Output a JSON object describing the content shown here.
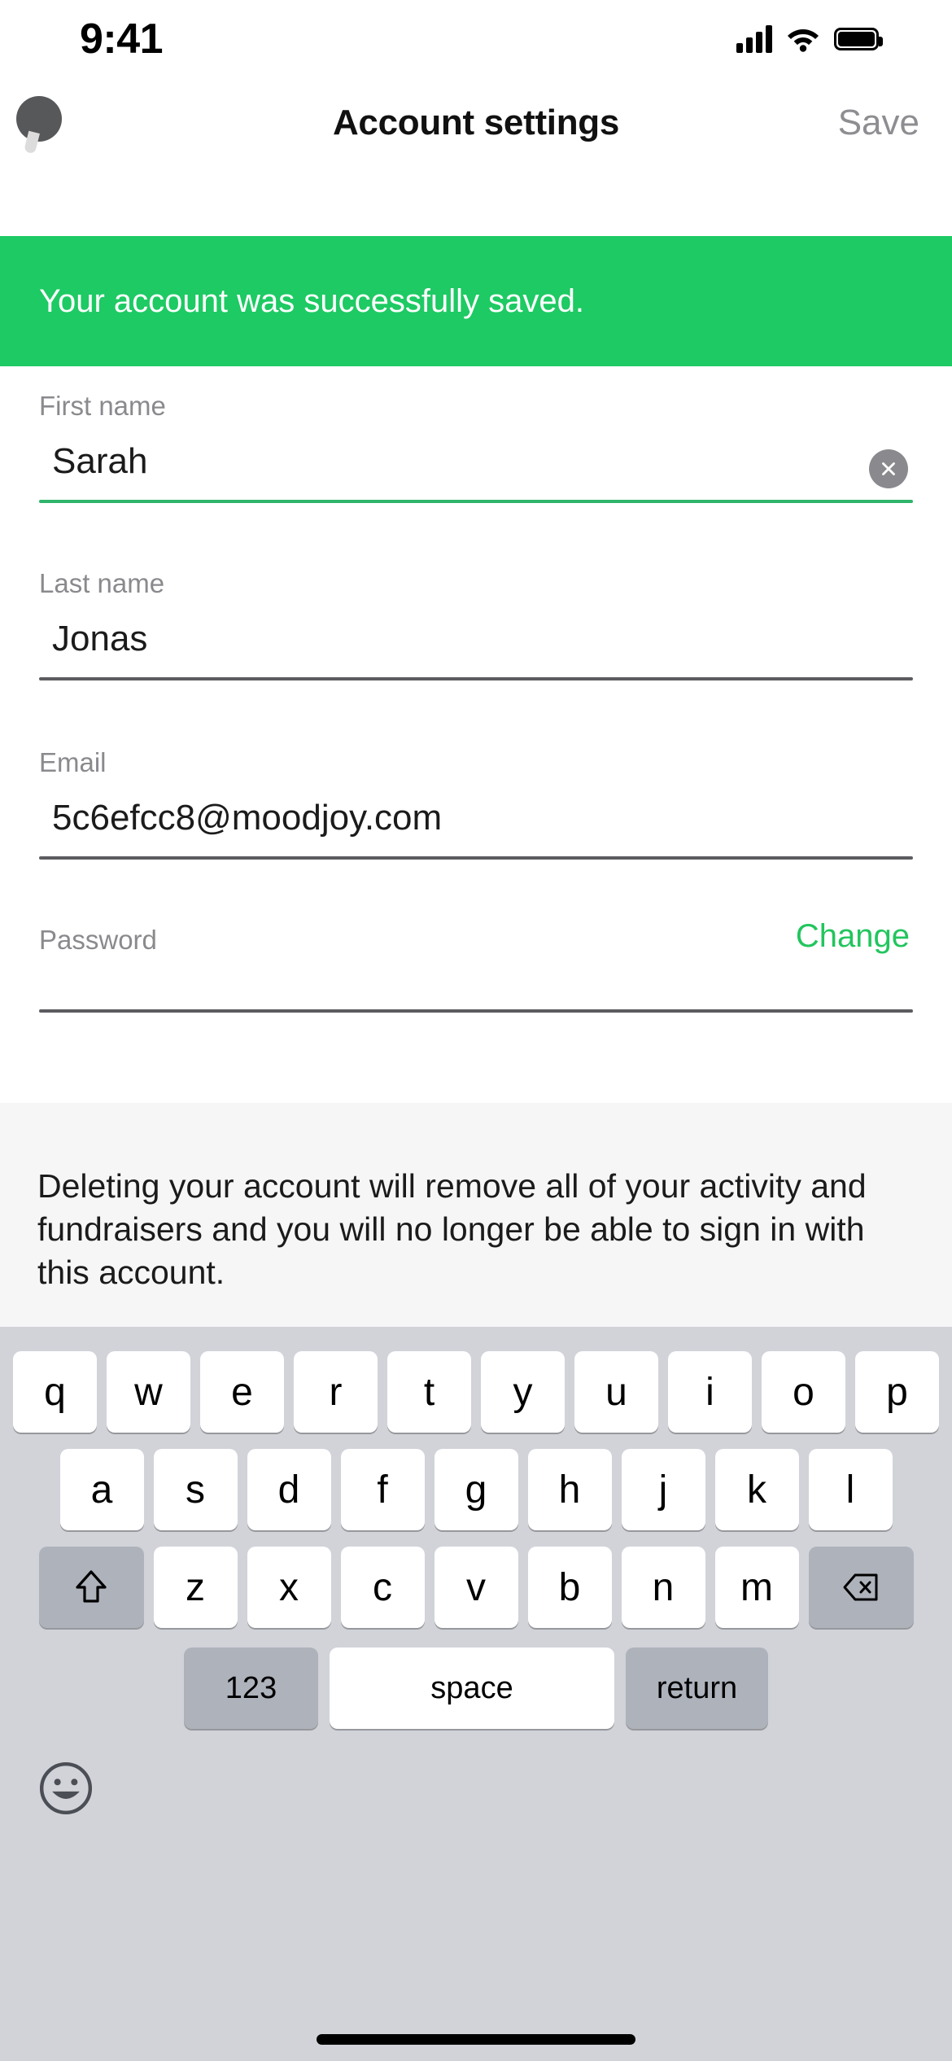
{
  "status_bar": {
    "time": "9:41",
    "cellular_icon": "cellular-bars-icon",
    "wifi_icon": "wifi-icon",
    "battery_icon": "battery-full-icon"
  },
  "nav_bar": {
    "avatar_icon": "avatar-icon",
    "title": "Account settings",
    "save_label": "Save"
  },
  "banner": {
    "message": "Your account was successfully saved.",
    "background_color": "#1dca63",
    "text_color": "#ffffff"
  },
  "form": {
    "fields": [
      {
        "label": "First name",
        "value": "Sarah",
        "placeholder": "First name",
        "focused": true,
        "has_clear_button": true,
        "clear_icon": "clear-circle-icon",
        "underline_color": "#2fb46a"
      },
      {
        "label": "Last name",
        "value": "Jonas",
        "placeholder": "Last name",
        "focused": false,
        "has_clear_button": false,
        "underline_color": "#5c5c60"
      },
      {
        "label": "Email",
        "value": "5c6efcc8@moodjoy.com",
        "placeholder": "Email",
        "focused": false,
        "has_clear_button": false,
        "underline_color": "#5c5c60"
      },
      {
        "label": "Password",
        "value": "",
        "placeholder": "Password",
        "focused": false,
        "has_clear_button": false,
        "action_label": "Change",
        "action_color": "#22c55e",
        "underline_color": "#5c5c60"
      }
    ]
  },
  "danger_section": {
    "description": "Deleting your account will remove all of your activity and fundraisers and you will no longer be able to sign in with this account.",
    "background_color": "#f6f6f7"
  },
  "keyboard": {
    "layout": "qwerty-lowercase",
    "row1": [
      "q",
      "w",
      "e",
      "r",
      "t",
      "y",
      "u",
      "i",
      "o",
      "p"
    ],
    "row2": [
      "a",
      "s",
      "d",
      "f",
      "g",
      "h",
      "j",
      "k",
      "l"
    ],
    "row3": [
      "z",
      "x",
      "c",
      "v",
      "b",
      "n",
      "m"
    ],
    "shift_icon": "shift-arrow-icon",
    "backspace_icon": "backspace-delete-icon",
    "numbers_label": "123",
    "space_label": "space",
    "return_label": "return",
    "emoji_icon": "emoji-smiley-icon",
    "background_color": "#d1d3d9",
    "key_color": "#ffffff",
    "function_key_color": "#aeb2bb"
  },
  "home_indicator": "home-indicator"
}
